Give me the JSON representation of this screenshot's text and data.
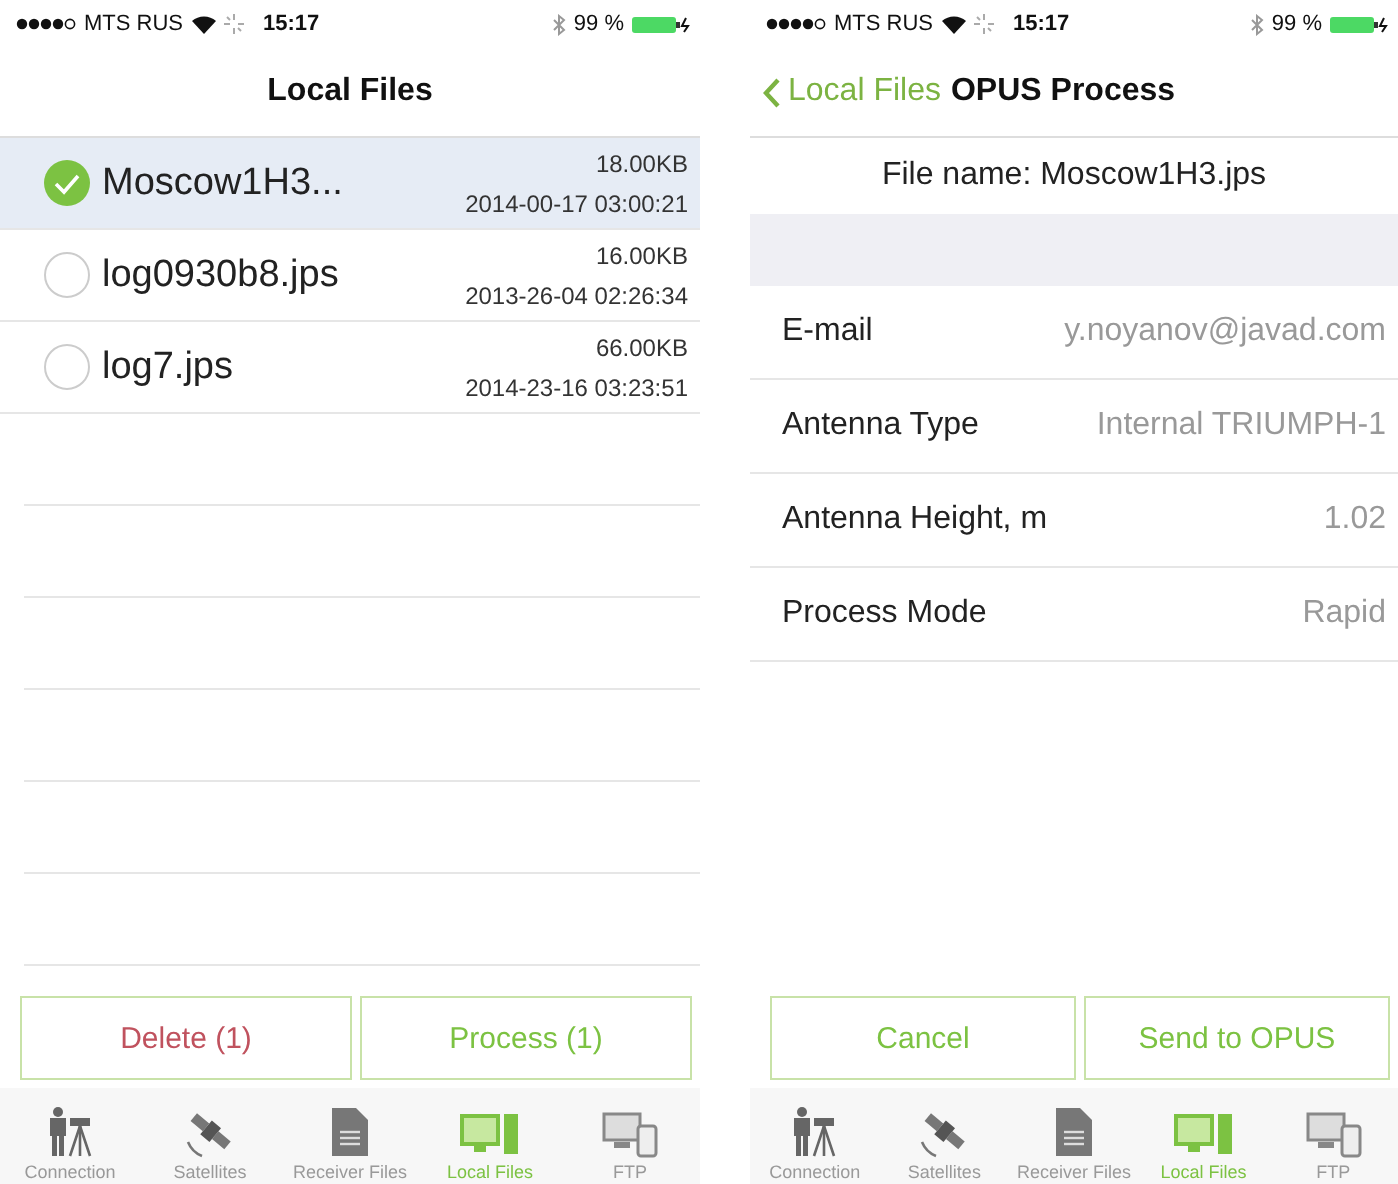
{
  "screens": [
    {
      "status_bar": {
        "carrier": "MTS RUS",
        "time": "15:17",
        "battery": "99 %"
      },
      "nav": {
        "title": "Local Files"
      },
      "files": [
        {
          "name": "Moscow1H3...",
          "size": "18.00KB",
          "date": "2014-00-17 03:00:21",
          "selected": true
        },
        {
          "name": "log0930b8.jps",
          "size": "16.00KB",
          "date": "2013-26-04 02:26:34",
          "selected": false
        },
        {
          "name": "log7.jps",
          "size": "66.00KB",
          "date": "2014-23-16 03:23:51",
          "selected": false
        }
      ],
      "buttons": [
        {
          "label": "Delete (1)",
          "kind": "destructive"
        },
        {
          "label": "Process (1)",
          "kind": "normal"
        }
      ],
      "tabs": [
        {
          "label": "Connection",
          "selected": false
        },
        {
          "label": "Satellites",
          "selected": false
        },
        {
          "label": "Receiver Files",
          "selected": false
        },
        {
          "label": "Local Files",
          "selected": true
        },
        {
          "label": "FTP",
          "selected": false
        }
      ]
    },
    {
      "status_bar": {
        "carrier": "MTS RUS",
        "time": "15:17",
        "battery": "99 %"
      },
      "nav": {
        "back": "Local Files",
        "title": "OPUS Process"
      },
      "file_name": "File name: Moscow1H3.jps",
      "fields": [
        {
          "label": "E-mail",
          "value": "y.noyanov@javad.com"
        },
        {
          "label": "Antenna Type",
          "value": "Internal TRIUMPH-1"
        },
        {
          "label": "Antenna Height, m",
          "value": "1.02"
        },
        {
          "label": "Process Mode",
          "value": "Rapid"
        }
      ],
      "buttons": [
        {
          "label": "Cancel",
          "kind": "normal"
        },
        {
          "label": "Send to OPUS",
          "kind": "normal"
        }
      ],
      "tabs": [
        {
          "label": "Connection",
          "selected": false
        },
        {
          "label": "Satellites",
          "selected": false
        },
        {
          "label": "Receiver Files",
          "selected": false
        },
        {
          "label": "Local Files",
          "selected": true
        },
        {
          "label": "FTP",
          "selected": false
        }
      ]
    }
  ]
}
